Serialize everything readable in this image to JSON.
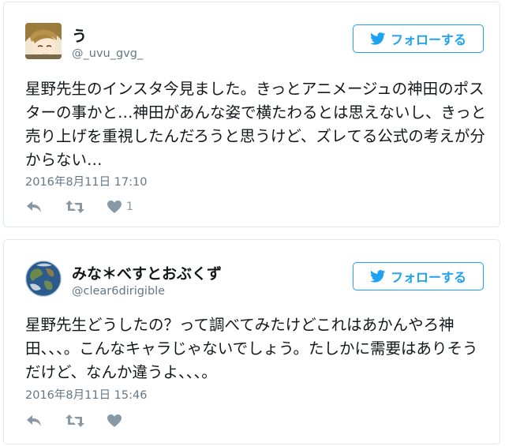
{
  "tweets": [
    {
      "name": "う",
      "handle": "@_uvu_gvg_",
      "follow_label": "フォローする",
      "text": "星野先生のインスタ今見ました。きっとアニメージュの神田のポスターの事かと…神田があんな姿で横たわるとは思えないし、きっと売り上げを重視したんだろうと思うけど、ズレてる公式の考えが分からない…",
      "date": "2016年8月11日 17:10",
      "like_count": "1",
      "icons": [
        "reply-icon",
        "retweet-icon",
        "heart-icon",
        "twitter-bird-icon"
      ]
    },
    {
      "name": "みな＊べすとおぶくず",
      "handle": "@clear6dirigible",
      "follow_label": "フォローする",
      "text": "星野先生どうしたの？って調べてみたけどこれはあかんやろ神田、、、。こんなキャラじゃないでしょう。たしかに需要はありそうだけど、なんか違うよ、、、。",
      "date": "2016年8月11日 15:46",
      "like_count": "",
      "icons": [
        "reply-icon",
        "retweet-icon",
        "heart-icon",
        "twitter-bird-icon"
      ]
    }
  ],
  "colors": {
    "accent": "#1da1f2",
    "muted": "#657786",
    "icon": "#8899a6",
    "border": "#e1e8ed"
  }
}
